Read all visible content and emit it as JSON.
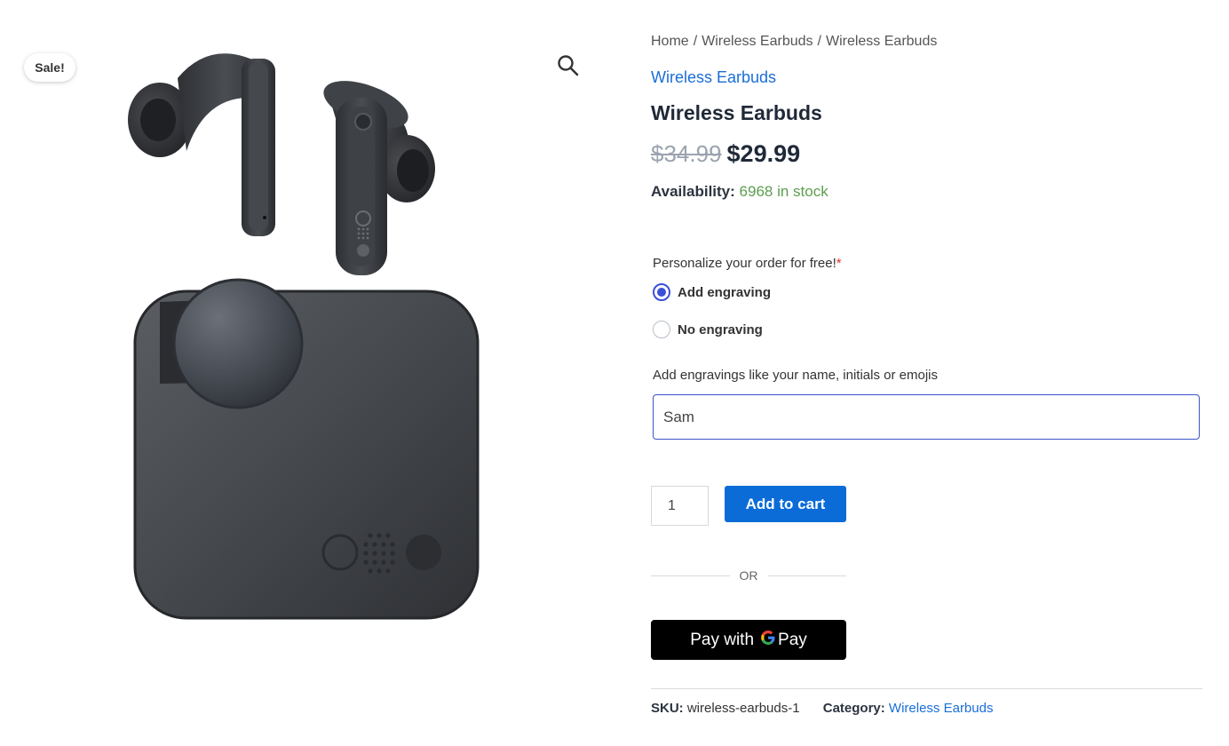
{
  "gallery": {
    "sale_badge": "Sale!",
    "zoom_icon": "magnifier-icon",
    "image_alt": "Wireless Earbuds"
  },
  "breadcrumb": {
    "items": [
      "Home",
      "Wireless Earbuds",
      "Wireless Earbuds"
    ],
    "separator": "/"
  },
  "product": {
    "category_link": "Wireless Earbuds",
    "title": "Wireless Earbuds",
    "old_price": "$34.99",
    "price": "$29.99",
    "availability_label": "Availability:",
    "availability_value": "6968 in stock"
  },
  "personalize": {
    "label": "Personalize your order for free!",
    "required_mark": "*",
    "options": [
      {
        "label": "Add engraving",
        "checked": true
      },
      {
        "label": "No engraving",
        "checked": false
      }
    ],
    "engraving_label": "Add engravings like your name, initials or emojis",
    "engraving_value": "Sam"
  },
  "cart": {
    "quantity": "1",
    "add_to_cart_label": "Add to cart",
    "or_label": "OR",
    "gpay_prefix": "Pay with",
    "gpay_suffix": "Pay"
  },
  "meta": {
    "sku_label": "SKU:",
    "sku_value": "wireless-earbuds-1",
    "category_label": "Category:",
    "category_value": "Wireless Earbuds"
  },
  "colors": {
    "link": "#1a6ed8",
    "button": "#0b6cd8",
    "stock": "#5c9d4f",
    "radio_accent": "#3b50d7",
    "product": "#3a3d41"
  }
}
